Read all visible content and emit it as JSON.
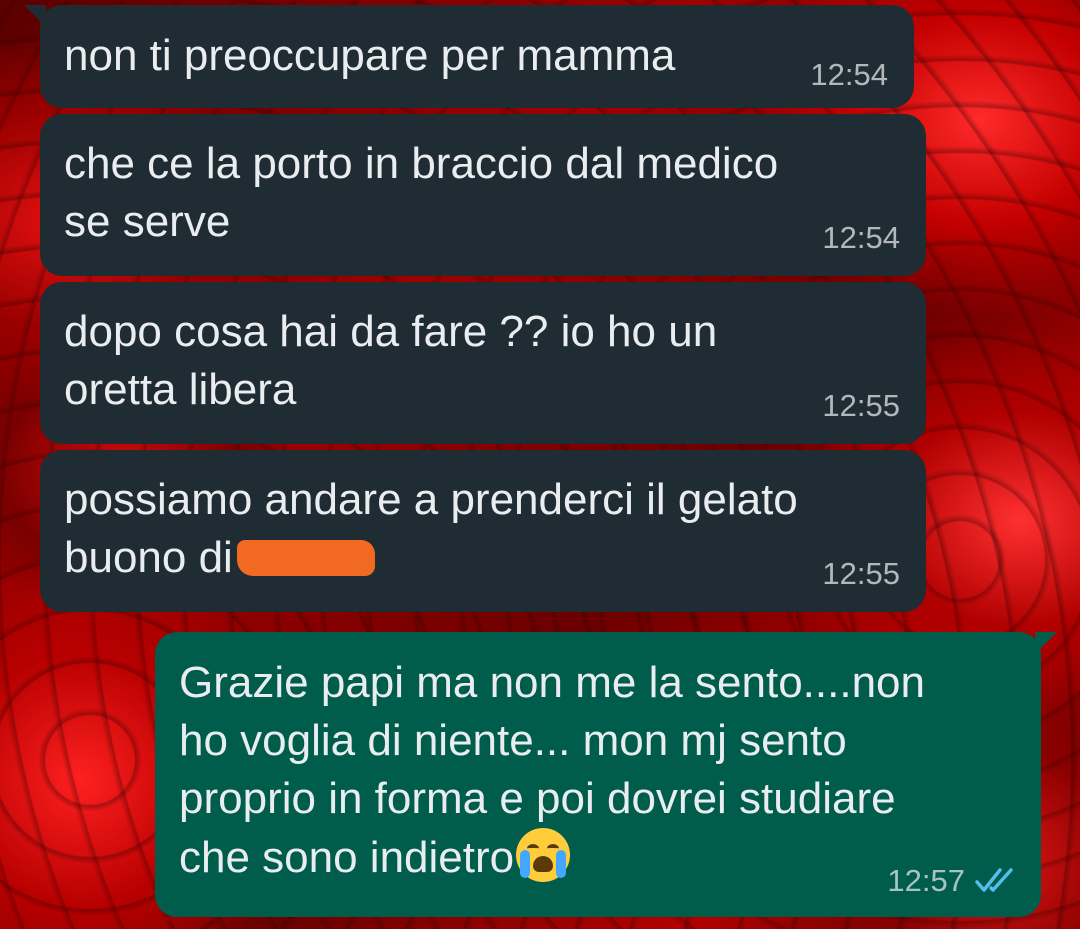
{
  "messages": [
    {
      "direction": "in",
      "text": "non ti preoccupare per mamma",
      "time": "12:54"
    },
    {
      "direction": "in",
      "text": "che ce la porto in braccio dal medico\nse serve",
      "time": "12:54"
    },
    {
      "direction": "in",
      "text": "dopo cosa hai da fare ?? io ho un\noretta libera",
      "time": "12:55"
    },
    {
      "direction": "in",
      "text_before_redaction": "possiamo andare a prenderci il gelato\nbuono di",
      "redacted": true,
      "time": "12:55"
    },
    {
      "direction": "out",
      "text": "Grazie papi ma non me la sento....non\nho voglia di niente... mon mj sento\nproprio in forma e poi dovrei studiare\nche sono indietro",
      "emoji": "loudly-crying-face-icon",
      "time": "12:57",
      "status": "read-double-check-icon"
    }
  ],
  "colors": {
    "incoming_bubble": "#202c33",
    "outgoing_bubble": "#005c4b",
    "message_text": "#e9edef",
    "read_ticks": "#53bdeb",
    "redaction": "#f26a22",
    "wallpaper": "#b00000"
  }
}
